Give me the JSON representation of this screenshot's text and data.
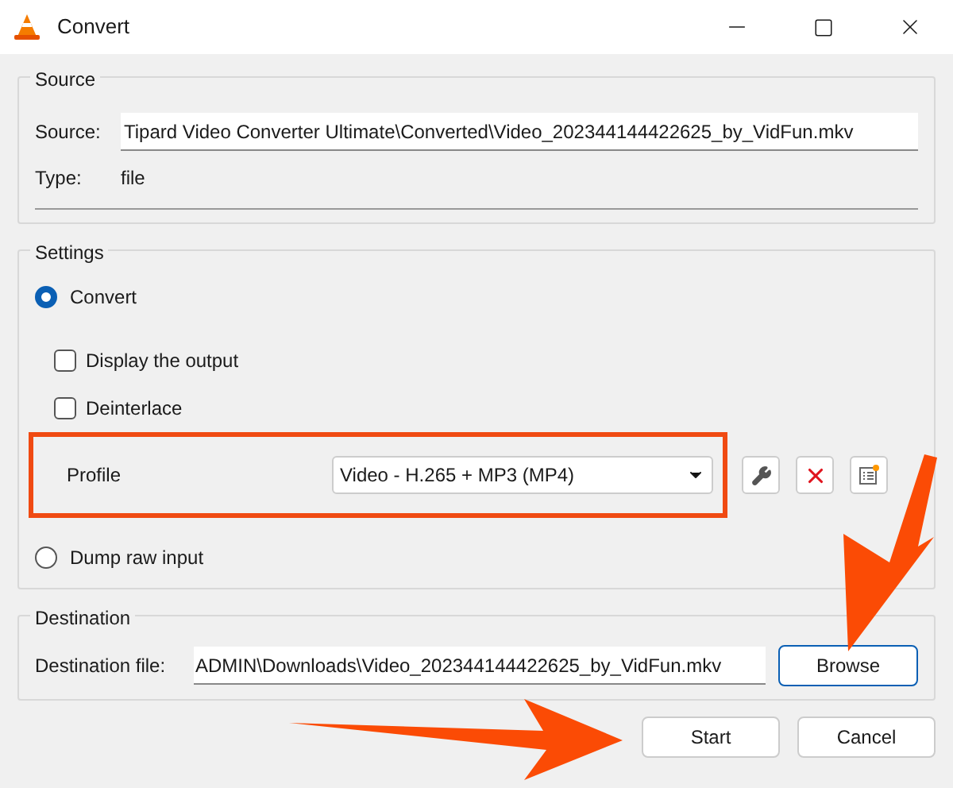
{
  "window": {
    "title": "Convert"
  },
  "source": {
    "heading": "Source",
    "source_label": "Source:",
    "source_value": "Tipard Video Converter Ultimate\\Converted\\Video_202344144422625_by_VidFun.mkv",
    "type_label": "Type:",
    "type_value": "file"
  },
  "settings": {
    "heading": "Settings",
    "modes": [
      {
        "label": "Convert",
        "selected": true
      },
      {
        "label": "Dump raw input",
        "selected": false
      }
    ],
    "options": [
      {
        "label": "Display the output",
        "checked": false
      },
      {
        "label": "Deinterlace",
        "checked": false
      }
    ],
    "profile_label": "Profile",
    "profile_value": "Video - H.265 + MP3 (MP4)"
  },
  "destination": {
    "heading": "Destination",
    "label": "Destination file:",
    "value": "ADMIN\\Downloads\\Video_202344144422625_by_VidFun.mkv",
    "browse": "Browse"
  },
  "buttons": [
    {
      "label": "Start"
    },
    {
      "label": "Cancel"
    }
  ]
}
